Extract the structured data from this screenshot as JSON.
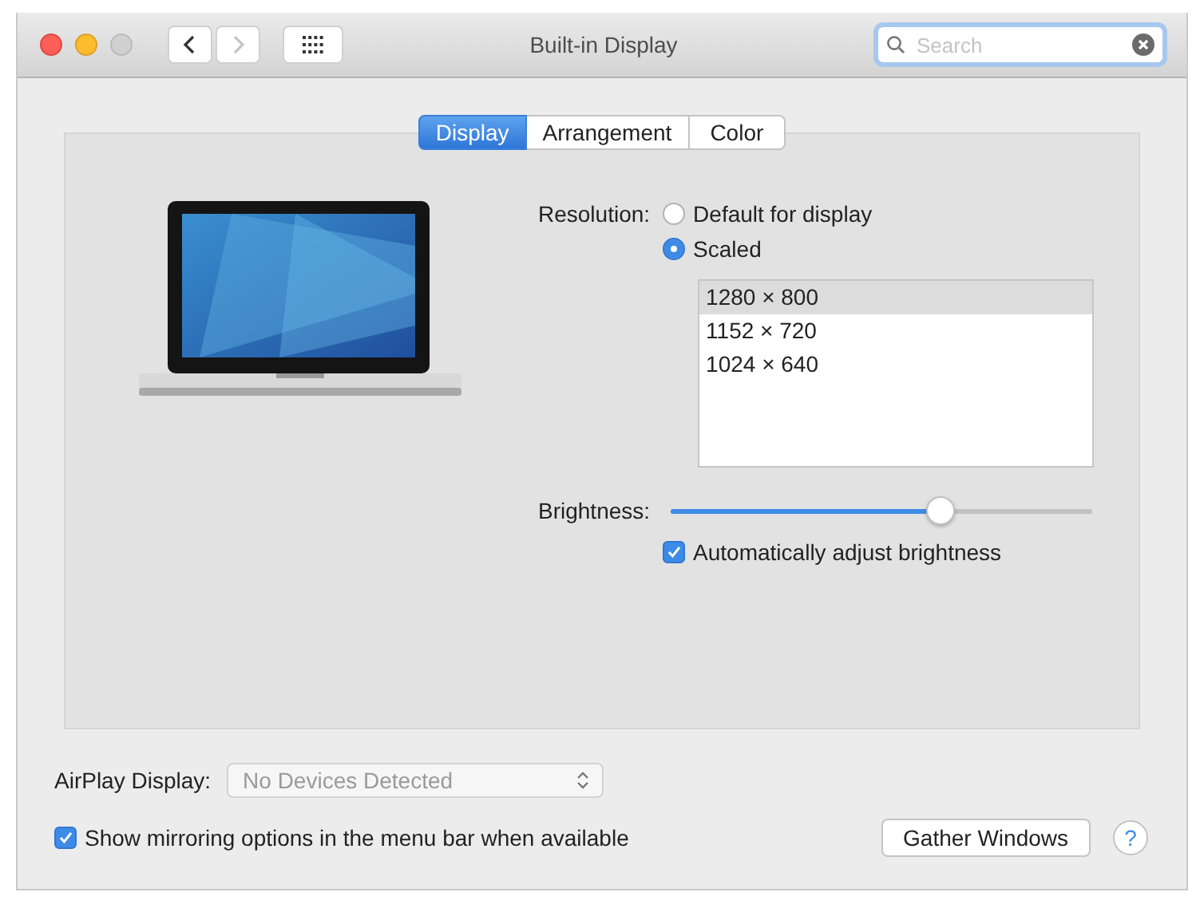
{
  "window": {
    "title": "Built-in Display"
  },
  "nav_buttons": [
    {
      "kind": "back",
      "disabled": false
    },
    {
      "kind": "forward",
      "disabled": true
    }
  ],
  "search": {
    "placeholder": "Search"
  },
  "tabs": [
    {
      "label": "Display",
      "selected": true
    },
    {
      "label": "Arrangement",
      "selected": false
    },
    {
      "label": "Color",
      "selected": false
    }
  ],
  "resolution": {
    "label": "Resolution:",
    "options": [
      {
        "label": "Default for display",
        "selected": false
      },
      {
        "label": "Scaled",
        "selected": true
      }
    ],
    "sizes": [
      {
        "label": "1280 × 800",
        "selected": true
      },
      {
        "label": "1152 × 720",
        "selected": false
      },
      {
        "label": "1024 × 640",
        "selected": false
      }
    ]
  },
  "brightness": {
    "label": "Brightness:",
    "level": 0.64,
    "auto": {
      "label": "Automatically adjust brightness",
      "checked": true
    }
  },
  "airplay": {
    "label": "AirPlay Display:",
    "value": "No Devices Detected",
    "disabled": true
  },
  "mirroring": {
    "label": "Show mirroring options in the menu bar when available",
    "checked": true
  },
  "gather_button": "Gather Windows",
  "help": "?"
}
